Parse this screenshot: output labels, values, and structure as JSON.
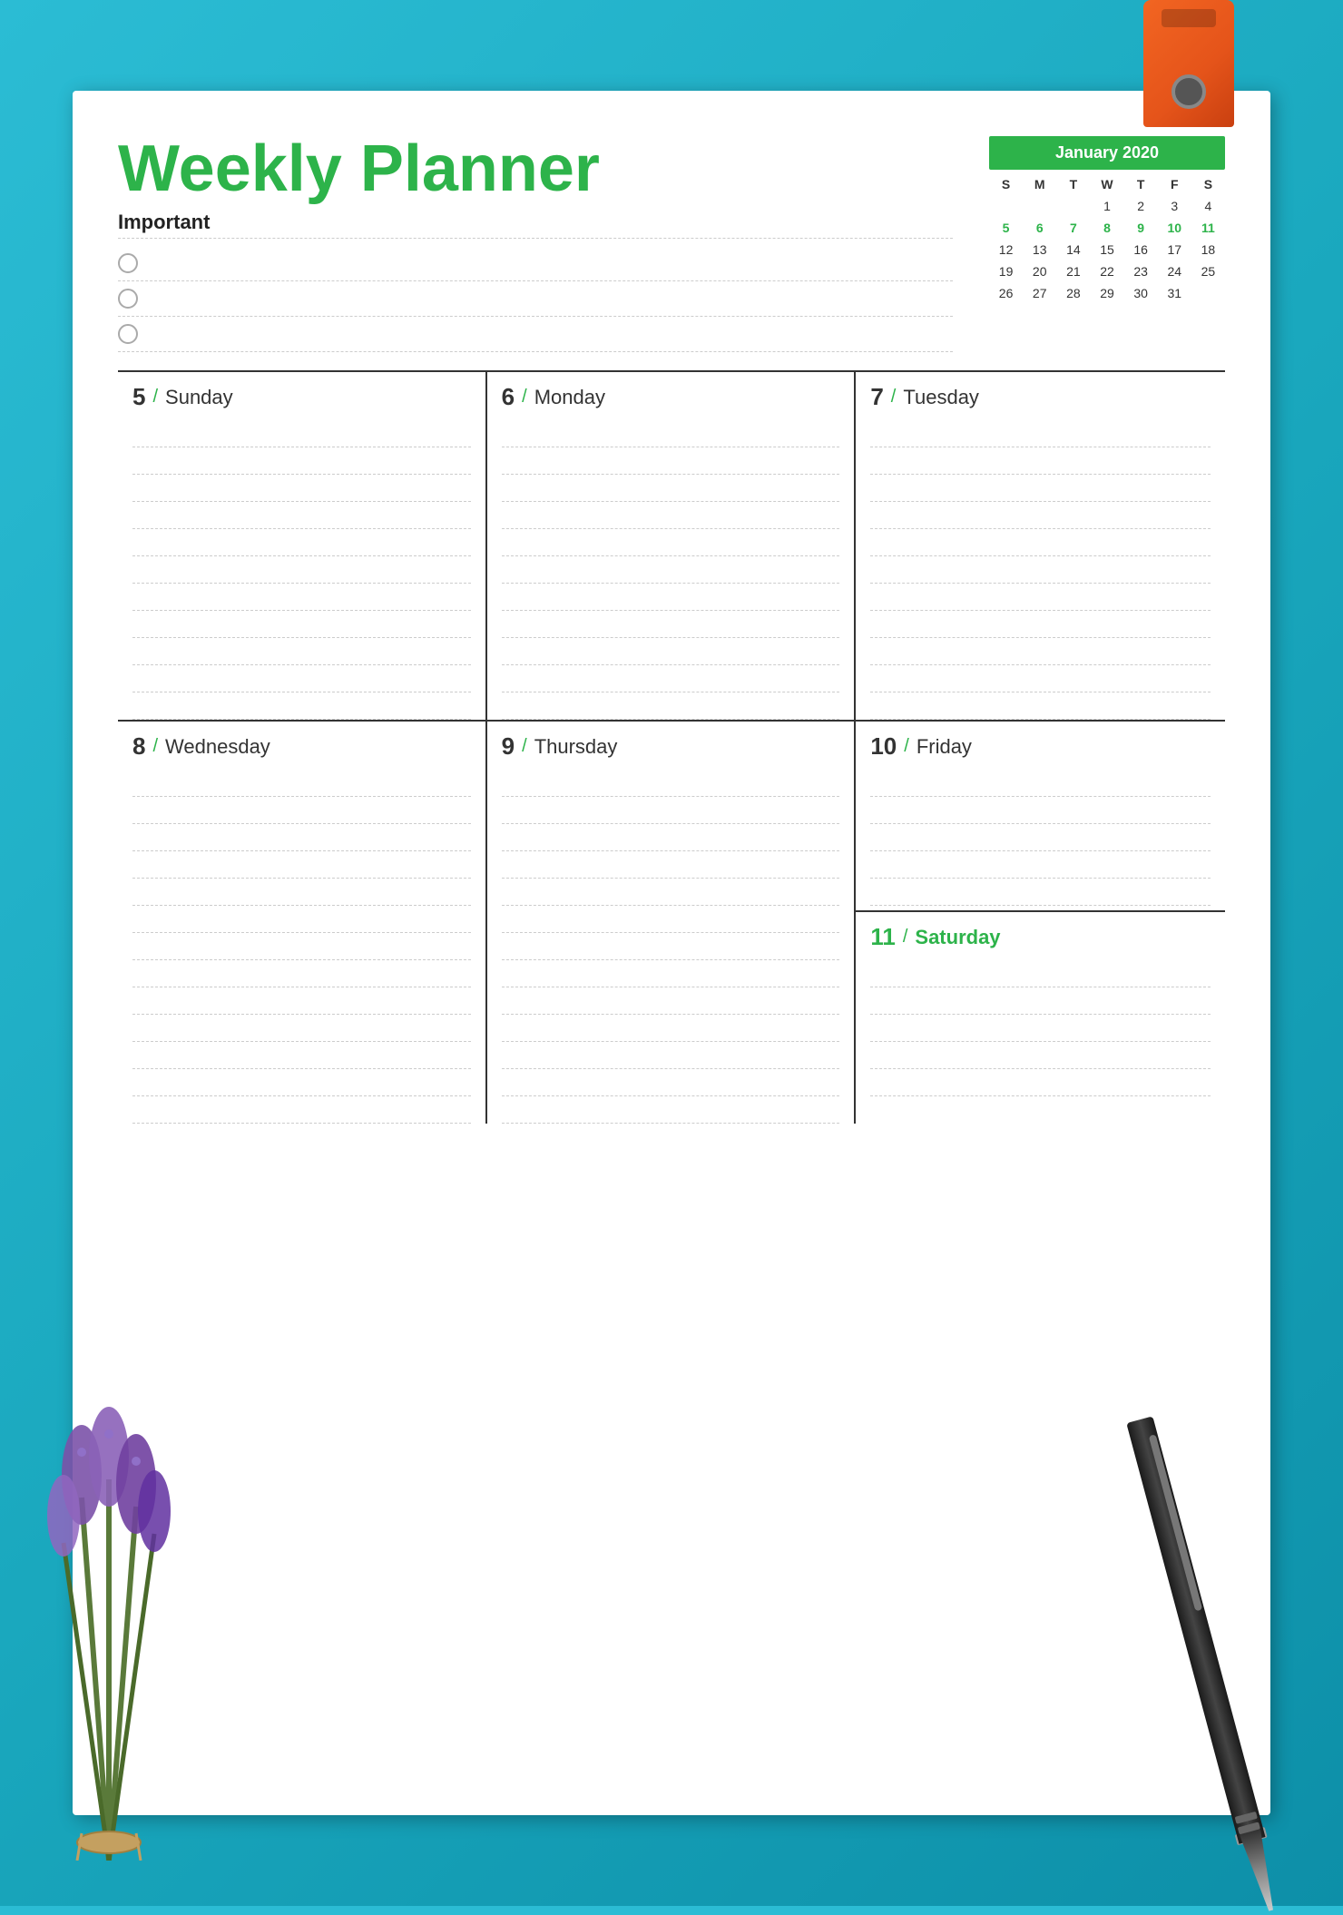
{
  "background": {
    "color": "#2bbcd4"
  },
  "planner": {
    "title": "Weekly Planner",
    "important_label": "Important",
    "todo_items": [
      "",
      "",
      ""
    ],
    "calendar": {
      "month_year": "January 2020",
      "headers": [
        "S",
        "M",
        "T",
        "W",
        "T",
        "F",
        "S"
      ],
      "rows": [
        [
          "",
          "",
          "",
          "1",
          "2",
          "3",
          "4"
        ],
        [
          "5",
          "6",
          "7",
          "8",
          "9",
          "10",
          "11"
        ],
        [
          "12",
          "13",
          "14",
          "15",
          "16",
          "17",
          "18"
        ],
        [
          "19",
          "20",
          "21",
          "22",
          "23",
          "24",
          "25"
        ],
        [
          "26",
          "27",
          "28",
          "29",
          "30",
          "31",
          ""
        ]
      ],
      "highlighted_dates": [
        "5",
        "6",
        "7",
        "8",
        "9",
        "10",
        "11"
      ]
    },
    "days": [
      {
        "number": "5",
        "name": "Sunday",
        "highlight": false
      },
      {
        "number": "6",
        "name": "Monday",
        "highlight": false
      },
      {
        "number": "7",
        "name": "Tuesday",
        "highlight": false
      },
      {
        "number": "8",
        "name": "Wednesday",
        "highlight": false
      },
      {
        "number": "9",
        "name": "Thursday",
        "highlight": false
      },
      {
        "number": "10",
        "name": "Friday",
        "highlight": false
      },
      {
        "number": "11",
        "name": "Saturday",
        "highlight": true
      }
    ],
    "lines_per_day": 12
  }
}
